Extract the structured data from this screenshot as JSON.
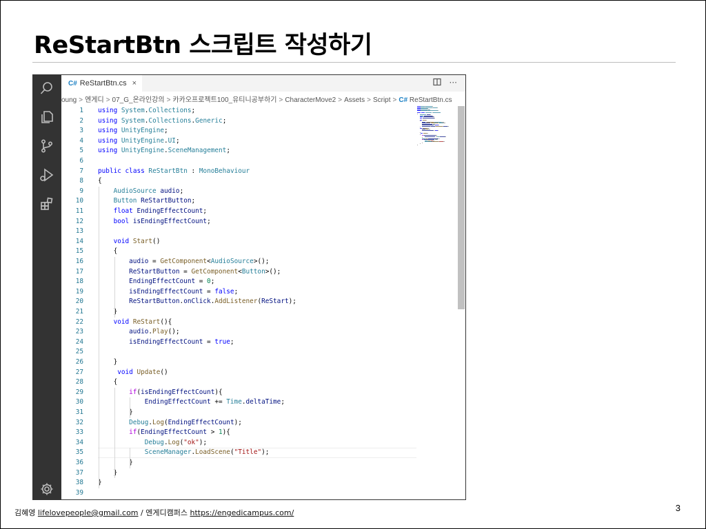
{
  "slide": {
    "title": "ReStartBtn 스크립트 작성하기",
    "page_number": "3",
    "footer": {
      "author": "김혜영",
      "email": "lifelovepeople@gmail.com",
      "separator": "/",
      "org": "엔게디캠퍼스",
      "url": "https://engedicampus.com/"
    }
  },
  "editor": {
    "tab": {
      "icon": "csharp-file-icon",
      "glyph": "C#",
      "label": "ReStartBtn.cs",
      "close": "×"
    },
    "breadcrumb": [
      "oung",
      "엔게디",
      "07_G_온라인강의",
      "카카오프로젝트100_유티니공부하기",
      "CharacterMove2",
      "Assets",
      "Script",
      "ReStartBtn.cs"
    ],
    "activity_icons": [
      "search-icon",
      "explorer-icon",
      "source-control-icon",
      "run-debug-icon",
      "extensions-icon",
      "settings-gear-icon"
    ],
    "current_line": 35,
    "code_lines": [
      [
        [
          "kw",
          "using"
        ],
        [
          "",
          " "
        ],
        [
          "ty",
          "System"
        ],
        [
          "",
          "."
        ],
        [
          "ty",
          "Collections"
        ],
        [
          "",
          ";"
        ]
      ],
      [
        [
          "kw",
          "using"
        ],
        [
          "",
          " "
        ],
        [
          "ty",
          "System"
        ],
        [
          "",
          "."
        ],
        [
          "ty",
          "Collections"
        ],
        [
          "",
          "."
        ],
        [
          "ty",
          "Generic"
        ],
        [
          "",
          ";"
        ]
      ],
      [
        [
          "kw",
          "using"
        ],
        [
          "",
          " "
        ],
        [
          "ty",
          "UnityEngine"
        ],
        [
          "",
          ";"
        ]
      ],
      [
        [
          "kw",
          "using"
        ],
        [
          "",
          " "
        ],
        [
          "ty",
          "UnityEngine"
        ],
        [
          "",
          "."
        ],
        [
          "ty",
          "UI"
        ],
        [
          "",
          ";"
        ]
      ],
      [
        [
          "kw",
          "using"
        ],
        [
          "",
          " "
        ],
        [
          "ty",
          "UnityEngine"
        ],
        [
          "",
          "."
        ],
        [
          "ty",
          "SceneManagement"
        ],
        [
          "",
          ";"
        ]
      ],
      [],
      [
        [
          "kw",
          "public"
        ],
        [
          "",
          " "
        ],
        [
          "kw",
          "class"
        ],
        [
          "",
          " "
        ],
        [
          "ty",
          "ReStartBtn"
        ],
        [
          "",
          " : "
        ],
        [
          "ty",
          "MonoBehaviour"
        ]
      ],
      [
        [
          "",
          "{"
        ]
      ],
      [
        [
          "",
          "    "
        ],
        [
          "ty",
          "AudioSource"
        ],
        [
          "",
          " "
        ],
        [
          "var",
          "audio"
        ],
        [
          "",
          ";"
        ]
      ],
      [
        [
          "",
          "    "
        ],
        [
          "ty",
          "Button"
        ],
        [
          "",
          " "
        ],
        [
          "var",
          "ReStartButton"
        ],
        [
          "",
          ";"
        ]
      ],
      [
        [
          "",
          "    "
        ],
        [
          "kw",
          "float"
        ],
        [
          "",
          " "
        ],
        [
          "var",
          "EndingEffectCount"
        ],
        [
          "",
          ";"
        ]
      ],
      [
        [
          "",
          "    "
        ],
        [
          "kw",
          "bool"
        ],
        [
          "",
          " "
        ],
        [
          "var",
          "isEndingEffectCount"
        ],
        [
          "",
          ";"
        ]
      ],
      [],
      [
        [
          "",
          "    "
        ],
        [
          "kw",
          "void"
        ],
        [
          "",
          " "
        ],
        [
          "fn",
          "Start"
        ],
        [
          "",
          "()"
        ]
      ],
      [
        [
          "",
          "    {"
        ]
      ],
      [
        [
          "",
          "        "
        ],
        [
          "var",
          "audio"
        ],
        [
          "",
          " = "
        ],
        [
          "fn",
          "GetComponent"
        ],
        [
          "",
          "<"
        ],
        [
          "ty",
          "AudioSource"
        ],
        [
          "",
          ">();"
        ]
      ],
      [
        [
          "",
          "        "
        ],
        [
          "var",
          "ReStartButton"
        ],
        [
          "",
          " = "
        ],
        [
          "fn",
          "GetComponent"
        ],
        [
          "",
          "<"
        ],
        [
          "ty",
          "Button"
        ],
        [
          "",
          ">();"
        ]
      ],
      [
        [
          "",
          "        "
        ],
        [
          "var",
          "EndingEffectCount"
        ],
        [
          "",
          " = "
        ],
        [
          "num",
          "0"
        ],
        [
          "",
          ";"
        ]
      ],
      [
        [
          "",
          "        "
        ],
        [
          "var",
          "isEndingEffectCount"
        ],
        [
          "",
          " = "
        ],
        [
          "kw",
          "false"
        ],
        [
          "",
          ";"
        ]
      ],
      [
        [
          "",
          "        "
        ],
        [
          "var",
          "ReStartButton"
        ],
        [
          "",
          "."
        ],
        [
          "var",
          "onClick"
        ],
        [
          "",
          "."
        ],
        [
          "fn",
          "AddListener"
        ],
        [
          "",
          "("
        ],
        [
          "var",
          "ReStart"
        ],
        [
          "",
          ");"
        ]
      ],
      [
        [
          "",
          "    }"
        ]
      ],
      [
        [
          "",
          "    "
        ],
        [
          "kw",
          "void"
        ],
        [
          "",
          " "
        ],
        [
          "fn",
          "ReStart"
        ],
        [
          "",
          "(){"
        ]
      ],
      [
        [
          "",
          "        "
        ],
        [
          "var",
          "audio"
        ],
        [
          "",
          "."
        ],
        [
          "fn",
          "Play"
        ],
        [
          "",
          "();"
        ]
      ],
      [
        [
          "",
          "        "
        ],
        [
          "var",
          "isEndingEffectCount"
        ],
        [
          "",
          " = "
        ],
        [
          "kw",
          "true"
        ],
        [
          "",
          ";"
        ]
      ],
      [],
      [
        [
          "",
          "    }"
        ]
      ],
      [
        [
          "",
          "     "
        ],
        [
          "kw",
          "void"
        ],
        [
          "",
          " "
        ],
        [
          "fn",
          "Update"
        ],
        [
          "",
          "()"
        ]
      ],
      [
        [
          "",
          "    {"
        ]
      ],
      [
        [
          "",
          "        "
        ],
        [
          "ctl",
          "if"
        ],
        [
          "",
          "("
        ],
        [
          "var",
          "isEndingEffectCount"
        ],
        [
          "",
          "){"
        ]
      ],
      [
        [
          "",
          "            "
        ],
        [
          "var",
          "EndingEffectCount"
        ],
        [
          "",
          " += "
        ],
        [
          "ty",
          "Time"
        ],
        [
          "",
          "."
        ],
        [
          "var",
          "deltaTime"
        ],
        [
          "",
          ";"
        ]
      ],
      [
        [
          "",
          "        }"
        ]
      ],
      [
        [
          "",
          "        "
        ],
        [
          "ty",
          "Debug"
        ],
        [
          "",
          "."
        ],
        [
          "fn",
          "Log"
        ],
        [
          "",
          "("
        ],
        [
          "var",
          "EndingEffectCount"
        ],
        [
          "",
          ");"
        ]
      ],
      [
        [
          "",
          "        "
        ],
        [
          "ctl",
          "if"
        ],
        [
          "",
          "("
        ],
        [
          "var",
          "EndingEffectCount"
        ],
        [
          "",
          " > "
        ],
        [
          "num",
          "1"
        ],
        [
          "",
          "){"
        ]
      ],
      [
        [
          "",
          "            "
        ],
        [
          "ty",
          "Debug"
        ],
        [
          "",
          "."
        ],
        [
          "fn",
          "Log"
        ],
        [
          "",
          "("
        ],
        [
          "str",
          "\"ok\""
        ],
        [
          "",
          ");"
        ]
      ],
      [
        [
          "",
          "            "
        ],
        [
          "ty",
          "SceneManager"
        ],
        [
          "",
          "."
        ],
        [
          "fn",
          "LoadScene"
        ],
        [
          "",
          "("
        ],
        [
          "str",
          "\"Title\""
        ],
        [
          "",
          ");"
        ]
      ],
      [
        [
          "",
          "        }"
        ]
      ],
      [
        [
          "",
          "    }"
        ]
      ],
      [
        [
          "",
          "}"
        ]
      ],
      []
    ]
  },
  "colors": {
    "activity_bar": "#333333",
    "keyword": "#0000ff",
    "type": "#267f99",
    "function": "#795e26",
    "variable": "#001080",
    "number": "#098658",
    "string": "#a31515",
    "line_number": "#237893"
  }
}
